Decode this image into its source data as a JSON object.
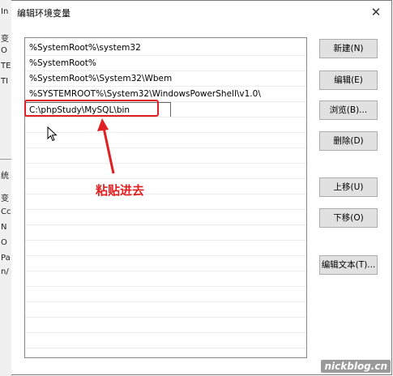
{
  "background_window": {
    "labels": [
      "In",
      "变",
      "O",
      "TE",
      "TI",
      "统",
      "变",
      "Cc",
      "N",
      "O",
      "Pa",
      "n/"
    ]
  },
  "dialog": {
    "title": "编辑环境变量",
    "close_glyph": "✕",
    "path_entries": [
      "%SystemRoot%\\system32",
      "%SystemRoot%",
      "%SystemRoot%\\System32\\Wbem",
      "%SYSTEMROOT%\\System32\\WindowsPowerShell\\v1.0\\",
      "C:\\phpStudy\\MySQL\\bin"
    ],
    "editing_value": "C:\\phpStudy\\MySQL\\bin",
    "buttons": {
      "new": "新建(N)",
      "edit": "编辑(E)",
      "browse": "浏览(B)...",
      "delete": "删除(D)",
      "move_up": "上移(U)",
      "move_down": "下移(O)",
      "edit_text": "编辑文本(T)..."
    }
  },
  "annotation": {
    "text": "粘贴进去",
    "color": "#e02020"
  },
  "watermark": "nickblog.cn"
}
